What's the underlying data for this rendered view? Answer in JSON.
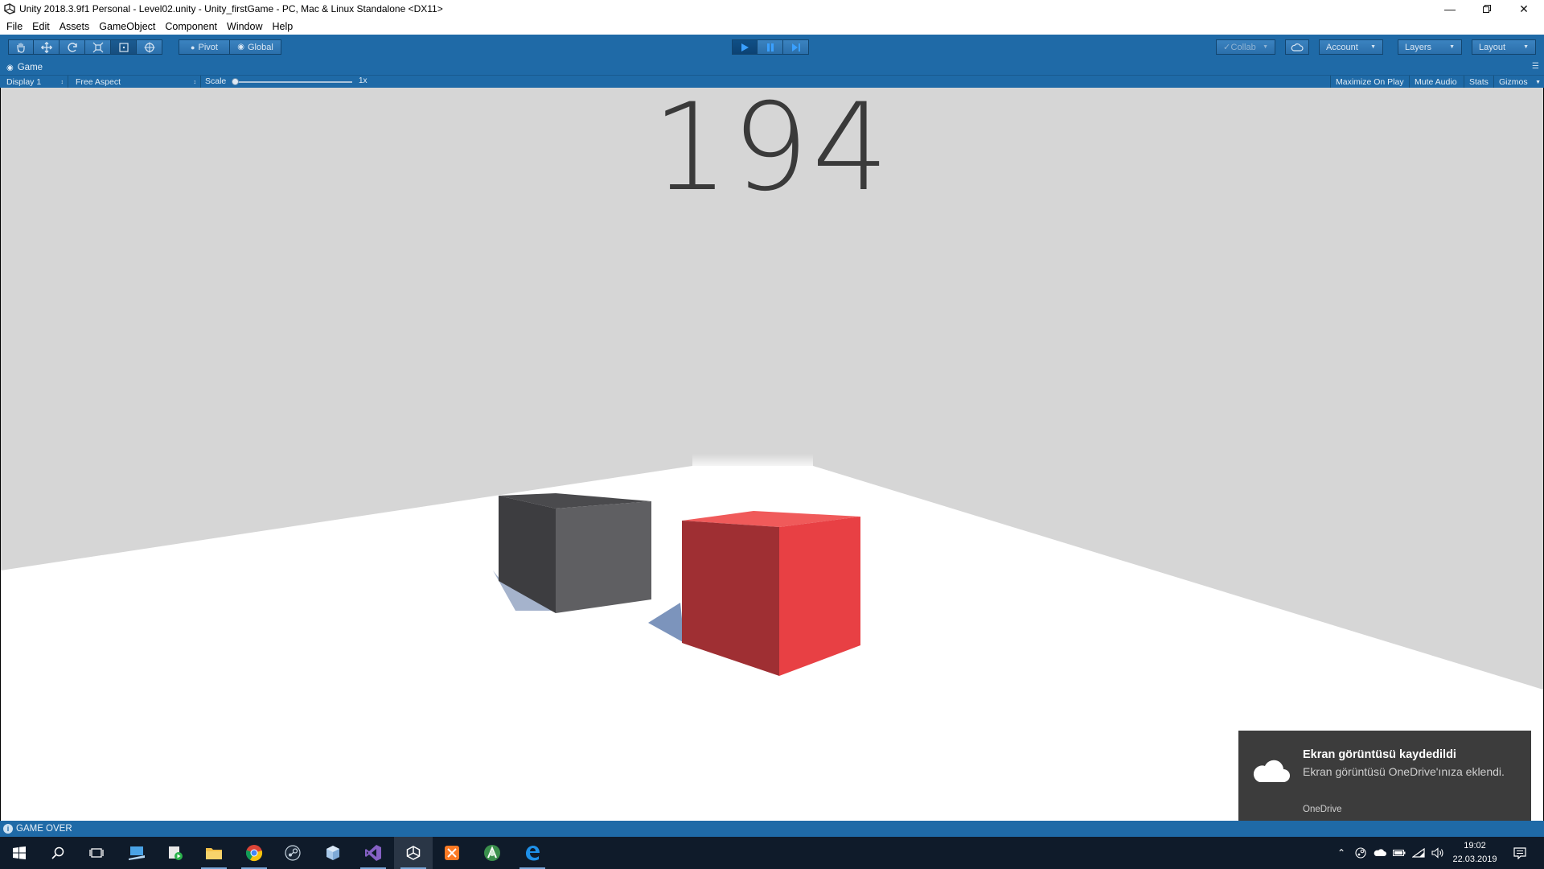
{
  "window": {
    "title": "Unity 2018.3.9f1 Personal - Level02.unity - Unity_firstGame - PC, Mac & Linux Standalone <DX11>"
  },
  "menu": [
    "File",
    "Edit",
    "Assets",
    "GameObject",
    "Component",
    "Window",
    "Help"
  ],
  "toolbar": {
    "pivot_label": "Pivot",
    "global_label": "Global",
    "collab_label": "Collab",
    "account_label": "Account",
    "layers_label": "Layers",
    "layout_label": "Layout"
  },
  "game_view": {
    "tab_label": "Game",
    "display_label": "Display 1",
    "aspect_label": "Free Aspect",
    "scale_label": "Scale",
    "scale_value": "1x",
    "maximize_label": "Maximize On Play",
    "mute_label": "Mute Audio",
    "stats_label": "Stats",
    "gizmos_label": "Gizmos",
    "score": "194"
  },
  "status": {
    "message": "GAME OVER"
  },
  "toast": {
    "title": "Ekran görüntüsü kaydedildi",
    "body": "Ekran görüntüsü OneDrive'ınıza eklendi.",
    "source": "OneDrive"
  },
  "taskbar": {
    "time": "19:02",
    "date": "22.03.2019"
  },
  "colors": {
    "unity_blue": "#1f6aa7",
    "red_cube": "#e84545",
    "grey_cube": "#5f5f62"
  }
}
